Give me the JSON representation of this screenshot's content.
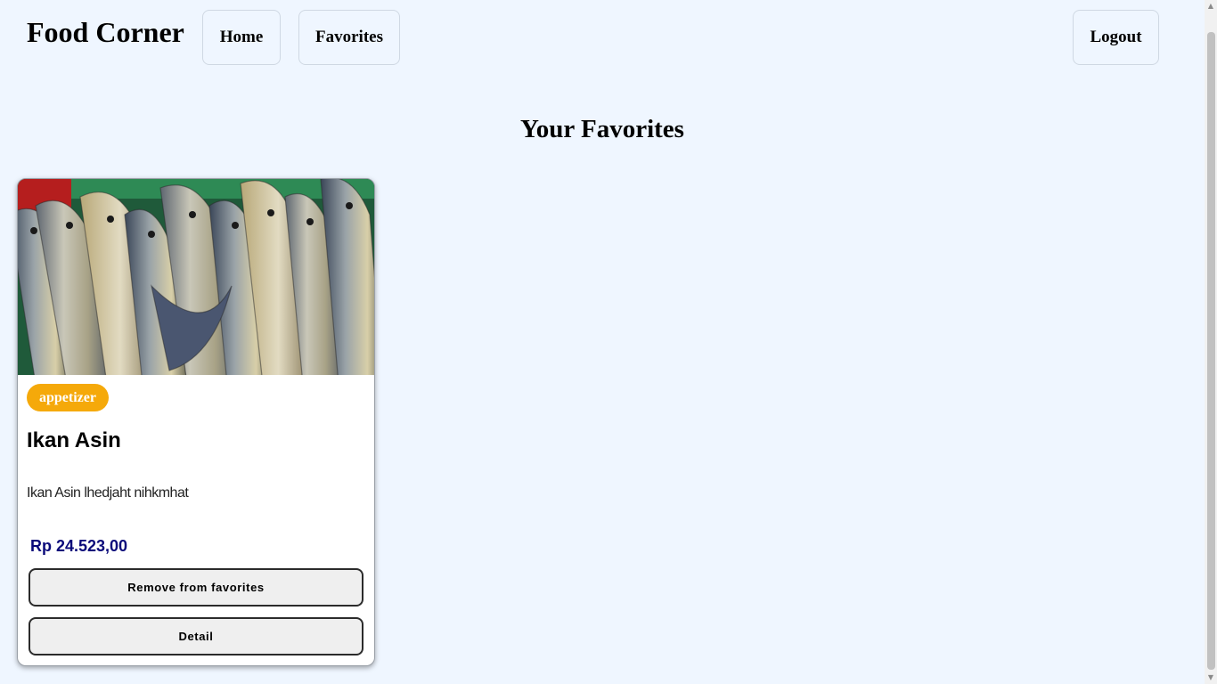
{
  "navbar": {
    "brand": "Food Corner",
    "home_label": "Home",
    "favorites_label": "Favorites",
    "logout_label": "Logout"
  },
  "main": {
    "title": "Your Favorites",
    "cards": [
      {
        "category": "appetizer",
        "name": "Ikan Asin",
        "description": "Ikan Asin lhedjaht nihkmhat",
        "price": "Rp 24.523,00",
        "remove_label": "Remove from favorites",
        "detail_label": "Detail"
      }
    ]
  },
  "colors": {
    "background": "#eff6ff",
    "badge": "#f5a90a",
    "price": "#0a0a7a"
  }
}
